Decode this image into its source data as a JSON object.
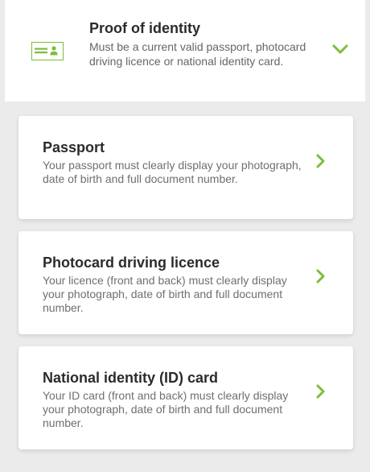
{
  "header": {
    "title": "Proof of identity",
    "description": "Must be a current valid passport, photocard driving licence or national identity card.",
    "icon": "id-card-icon",
    "toggle_icon": "chevron-down-icon"
  },
  "options": [
    {
      "title": "Passport",
      "description": "Your passport must clearly display your photograph, date of birth and full document number.",
      "icon": "chevron-right-icon"
    },
    {
      "title": "Photocard driving licence",
      "description": "Your licence (front and back) must clearly display your photograph, date of birth and full document number.",
      "icon": "chevron-right-icon"
    },
    {
      "title": "National identity (ID) card",
      "description": "Your ID card (front and back) must clearly display your photograph, date of birth and full document number.",
      "icon": "chevron-right-icon"
    }
  ],
  "colors": {
    "accent": "#7cbd3a",
    "background": "#ebebeb",
    "card": "#ffffff",
    "title_text": "#2b2b2b",
    "body_text": "#666666"
  }
}
